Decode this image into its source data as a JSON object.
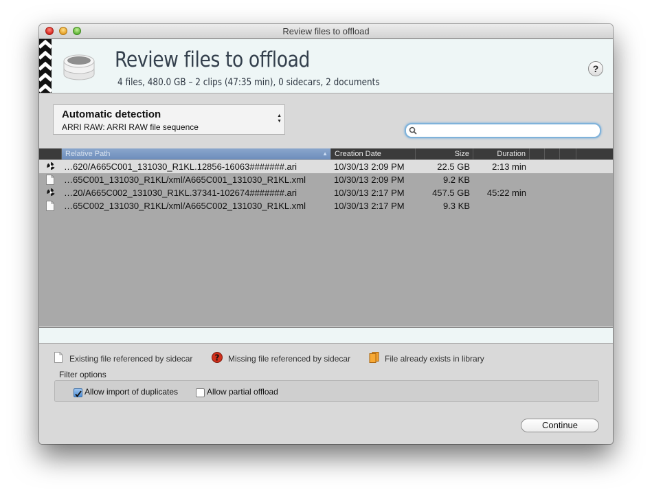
{
  "window": {
    "title": "Review files to offload"
  },
  "header": {
    "title": "Review files to offload",
    "subtitle": "4 files, 480.0 GB – 2 clips (47:35 min), 0 sidecars, 2 documents",
    "help_label": "?"
  },
  "format_select": {
    "selected": "Automatic detection",
    "detail": "ARRI RAW: ARRI RAW file sequence"
  },
  "search": {
    "value": "",
    "placeholder": ""
  },
  "table": {
    "columns": [
      "Relative Path",
      "Creation Date",
      "Size",
      "Duration"
    ],
    "sorted_column": "Relative Path",
    "rows": [
      {
        "icon": "arri-clip-icon",
        "path": "…620/A665C001_131030_R1KL.12856-16063#######.ari",
        "date": "10/30/13 2:09 PM",
        "size": "22.5 GB",
        "duration": "2:13 min",
        "selected": true
      },
      {
        "icon": "document-icon",
        "path": "…65C001_131030_R1KL/xml/A665C001_131030_R1KL.xml",
        "date": "10/30/13 2:09 PM",
        "size": "9.2 KB",
        "duration": "",
        "selected": false
      },
      {
        "icon": "arri-clip-icon",
        "path": "…20/A665C002_131030_R1KL.37341-102674#######.ari",
        "date": "10/30/13 2:17 PM",
        "size": "457.5 GB",
        "duration": "45:22 min",
        "selected": false
      },
      {
        "icon": "document-icon",
        "path": "…65C002_131030_R1KL/xml/A665C002_131030_R1KL.xml",
        "date": "10/30/13 2:17 PM",
        "size": "9.3 KB",
        "duration": "",
        "selected": false
      }
    ]
  },
  "legend": {
    "existing": "Existing file referenced by sidecar",
    "missing": "Missing file referenced by sidecar",
    "exists_in_library": "File already exists in library"
  },
  "filter": {
    "label": "Filter options",
    "allow_duplicates": {
      "label": "Allow import of duplicates",
      "checked": true
    },
    "allow_partial": {
      "label": "Allow partial offload",
      "checked": false
    }
  },
  "actions": {
    "continue_label": "Continue"
  },
  "colors": {
    "header_bg": "#eef6f6",
    "table_bg": "#a9a9a9",
    "table_header_bg": "#3b3b3b",
    "sorted_header": "#7b98c3",
    "search_focus": "#7fb2da"
  }
}
